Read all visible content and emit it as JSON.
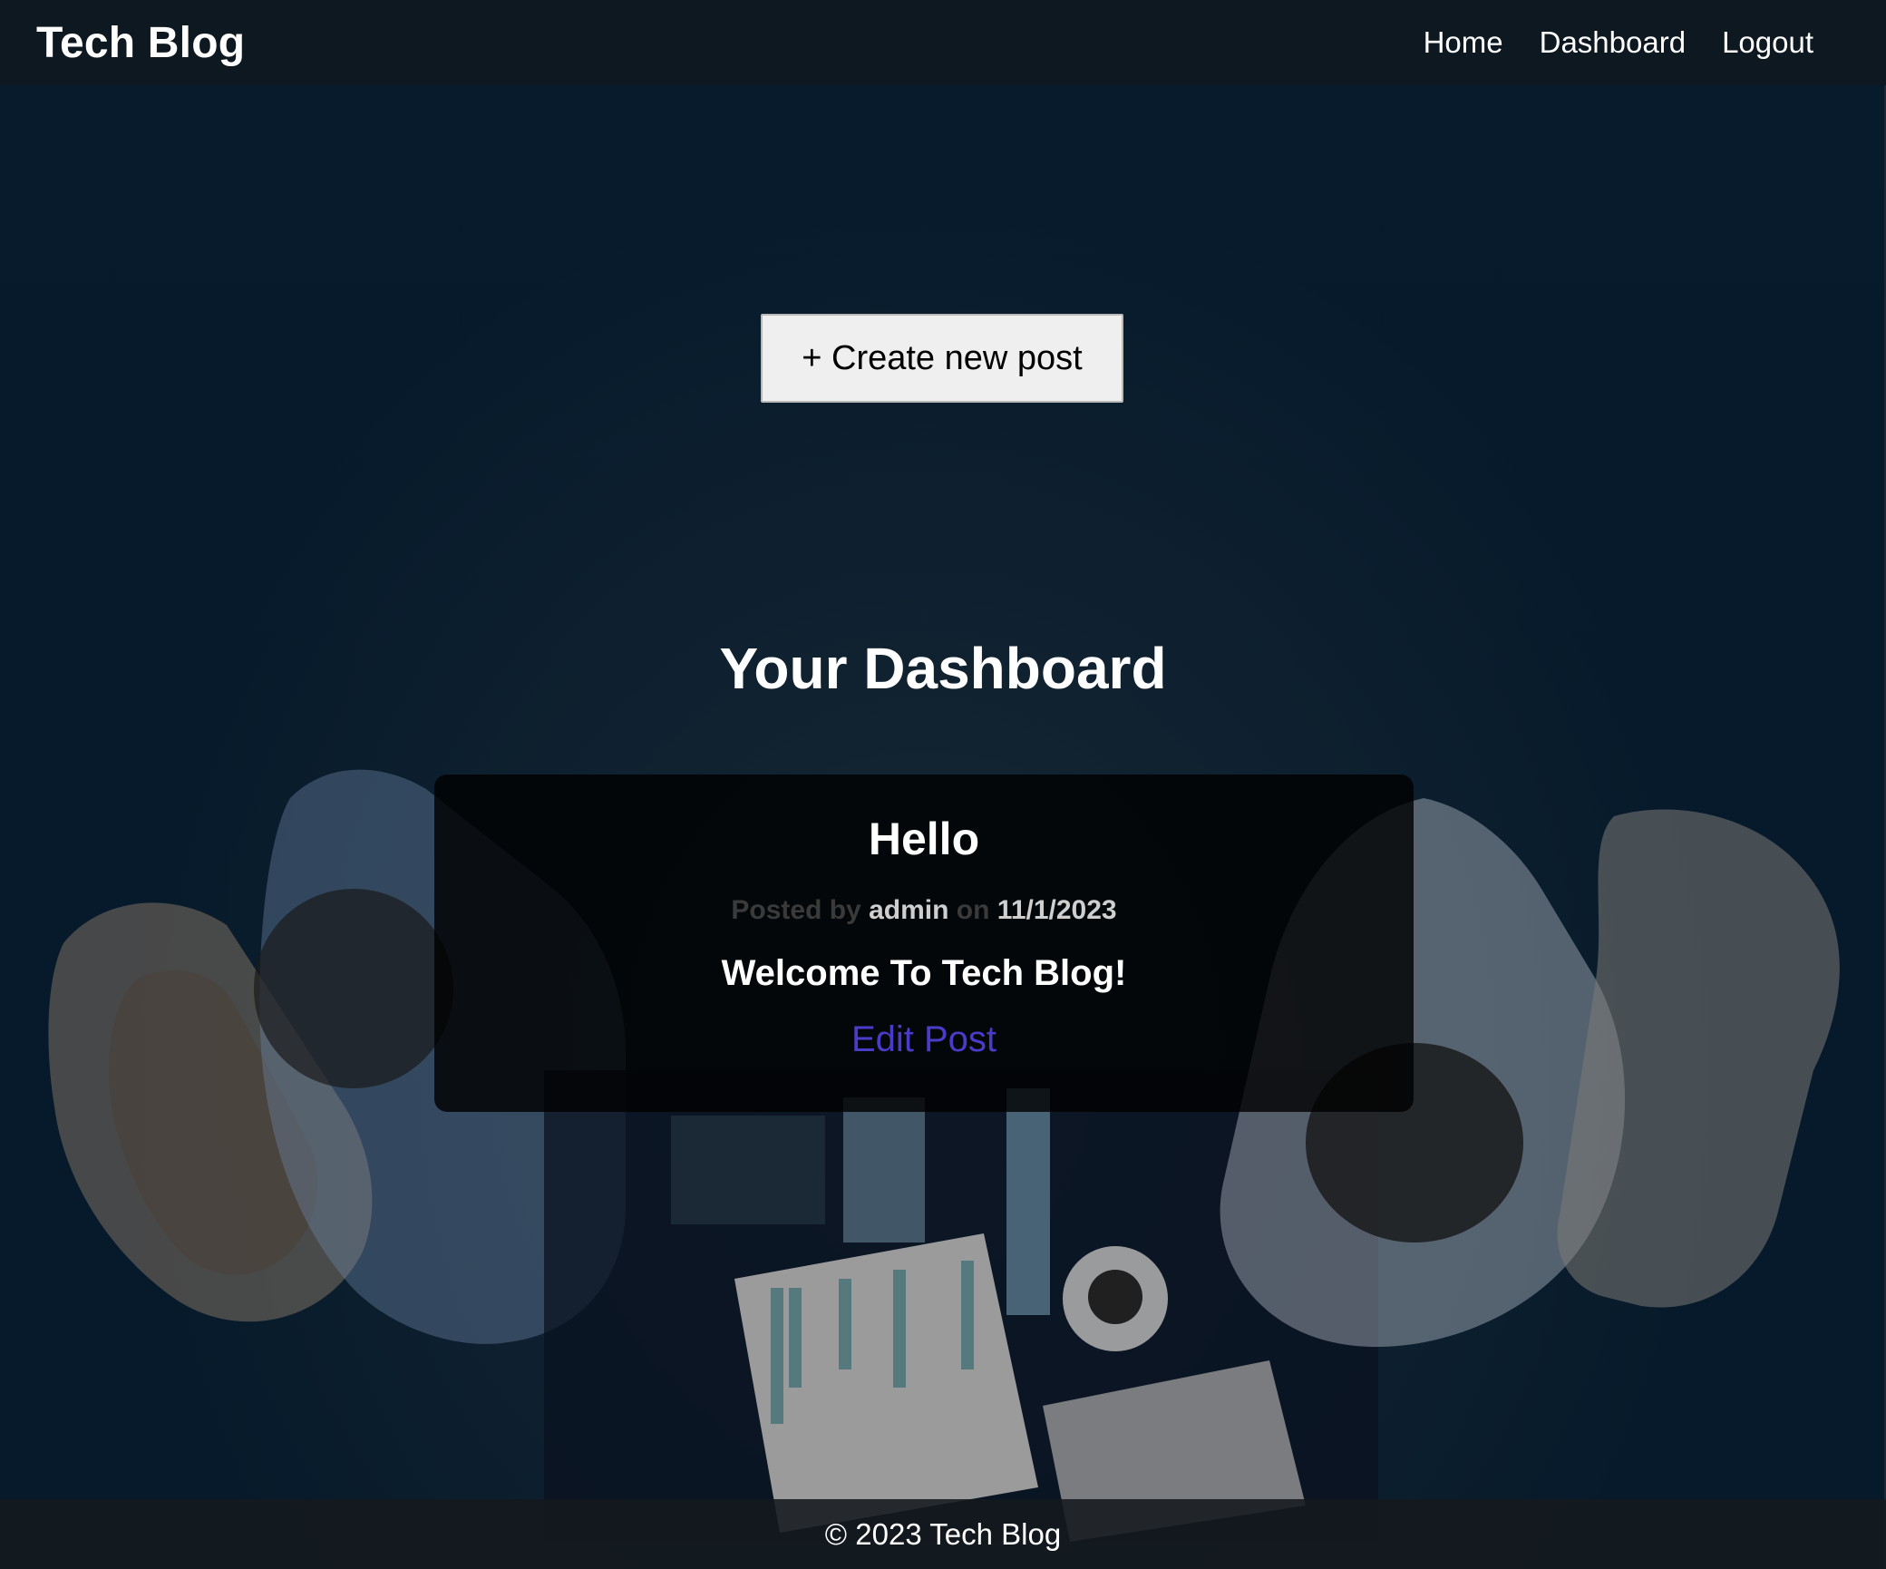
{
  "nav": {
    "brand": "Tech Blog",
    "links": {
      "home": "Home",
      "dashboard": "Dashboard",
      "logout": "Logout"
    }
  },
  "actions": {
    "create_new_post": "+ Create new post"
  },
  "dashboard": {
    "title": "Your Dashboard"
  },
  "post": {
    "title": "Hello",
    "meta": {
      "posted_by": "Posted by",
      "author": "admin",
      "on": "on",
      "date": "11/1/2023"
    },
    "body": "Welcome To Tech Blog!",
    "edit_label": "Edit Post"
  },
  "footer": {
    "text": "© 2023 Tech Blog"
  },
  "colors": {
    "background": "#061a2b",
    "nav_background": "#0e1821",
    "link_color": "#4a3cc8"
  }
}
